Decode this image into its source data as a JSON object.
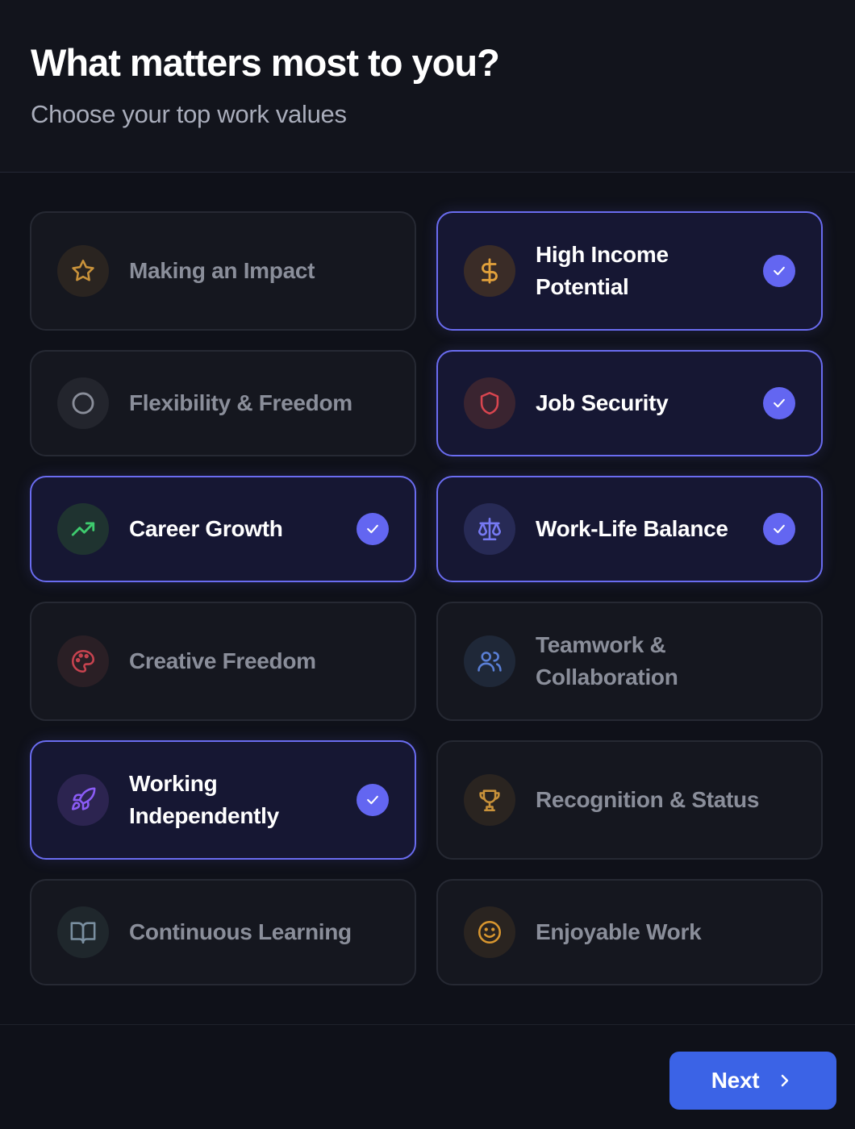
{
  "header": {
    "title": "What matters most to you?",
    "subtitle": "Choose your top work values"
  },
  "values": [
    {
      "label": "Making an Impact",
      "icon": "star-icon",
      "selected": false,
      "color": "#c9923a"
    },
    {
      "label": "High Income Potential",
      "icon": "dollar-icon",
      "selected": true,
      "color": "#e2a13b"
    },
    {
      "label": "Flexibility & Freedom",
      "icon": "circle-icon",
      "selected": false,
      "color": "#8a8e9a"
    },
    {
      "label": "Job Security",
      "icon": "shield-icon",
      "selected": true,
      "color": "#d9454f"
    },
    {
      "label": "Career Growth",
      "icon": "trending-up-icon",
      "selected": true,
      "color": "#3ecb6e"
    },
    {
      "label": "Work-Life Balance",
      "icon": "scale-icon",
      "selected": true,
      "color": "#7679f2"
    },
    {
      "label": "Creative Freedom",
      "icon": "palette-icon",
      "selected": false,
      "color": "#c7434f"
    },
    {
      "label": "Teamwork & Collaboration",
      "icon": "users-icon",
      "selected": false,
      "color": "#5a7fd6"
    },
    {
      "label": "Working Independently",
      "icon": "rocket-icon",
      "selected": true,
      "color": "#8b5cf6"
    },
    {
      "label": "Recognition & Status",
      "icon": "trophy-icon",
      "selected": false,
      "color": "#c9923a"
    },
    {
      "label": "Continuous Learning",
      "icon": "book-icon",
      "selected": false,
      "color": "#7a8fa0"
    },
    {
      "label": "Enjoyable Work",
      "icon": "smile-icon",
      "selected": false,
      "color": "#d8962f"
    }
  ],
  "footer": {
    "next_label": "Next"
  }
}
